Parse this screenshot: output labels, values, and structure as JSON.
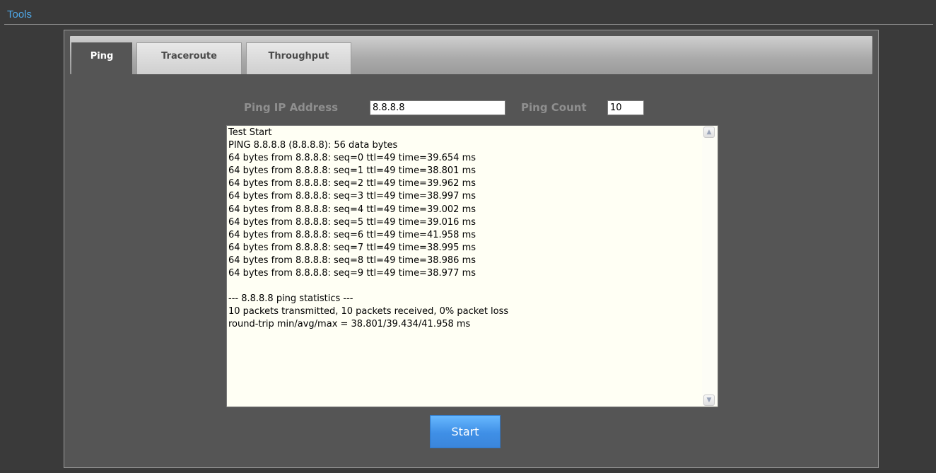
{
  "section": {
    "title": "Tools"
  },
  "tabs": [
    {
      "label": "Ping",
      "active": true
    },
    {
      "label": "Traceroute",
      "active": false
    },
    {
      "label": "Throughput",
      "active": false
    }
  ],
  "form": {
    "ip_label": "Ping IP Address",
    "ip_value": "8.8.8.8",
    "count_label": "Ping Count",
    "count_value": "10"
  },
  "output": {
    "lines": "Test Start\nPING 8.8.8.8 (8.8.8.8): 56 data bytes\n64 bytes from 8.8.8.8: seq=0 ttl=49 time=39.654 ms\n64 bytes from 8.8.8.8: seq=1 ttl=49 time=38.801 ms\n64 bytes from 8.8.8.8: seq=2 ttl=49 time=39.962 ms\n64 bytes from 8.8.8.8: seq=3 ttl=49 time=38.997 ms\n64 bytes from 8.8.8.8: seq=4 ttl=49 time=39.002 ms\n64 bytes from 8.8.8.8: seq=5 ttl=49 time=39.016 ms\n64 bytes from 8.8.8.8: seq=6 ttl=49 time=41.958 ms\n64 bytes from 8.8.8.8: seq=7 ttl=49 time=38.995 ms\n64 bytes from 8.8.8.8: seq=8 ttl=49 time=38.986 ms\n64 bytes from 8.8.8.8: seq=9 ttl=49 time=38.977 ms\n\n--- 8.8.8.8 ping statistics ---\n10 packets transmitted, 10 packets received, 0% packet loss\nround-trip min/avg/max = 38.801/39.434/41.958 ms"
  },
  "actions": {
    "start_label": "Start"
  },
  "icons": {
    "scroll_up": "chevron-up-icon",
    "scroll_down": "chevron-down-icon"
  },
  "colors": {
    "accent": "#4fa8e8",
    "button": "#4a9af0",
    "panel": "#555555",
    "background": "#3a3a3a"
  }
}
